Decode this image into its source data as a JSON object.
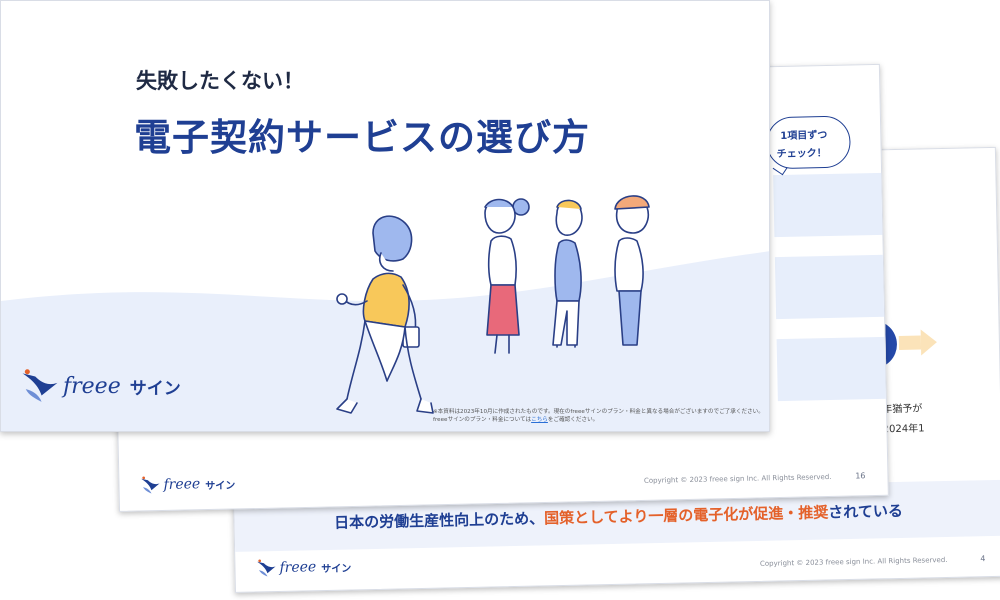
{
  "brand": {
    "logo_word": "freee",
    "logo_suffix": "サイン",
    "primary_color": "#1f3f93",
    "accent_color": "#e4612a"
  },
  "back_slide": {
    "band_text_prefix": "日本の労働生産性向上のため、",
    "band_text_highlight": "国策としてより一層の電子化が促進・推奨",
    "band_text_suffix": "されている",
    "side_text_1": "年猶予が",
    "side_text_2": "。2024年1",
    "copyright": "Copyright © 2023 freee sign Inc. All Rights Reserved.",
    "page_number": "4"
  },
  "middle_slide": {
    "bubble_line_1": "1項目ずつ",
    "bubble_line_2": "チェック！",
    "copyright": "Copyright © 2023 freee sign Inc. All Rights Reserved.",
    "page_number": "16"
  },
  "front_slide": {
    "subtitle": "失敗したくない！",
    "title": "電子契約サービスの選び方",
    "note_line_1": "※本資料は2023年10月に作成されたものです。現在のfreeeサインのプラン・料金と異なる場合がございますのでご了承ください。",
    "note_line_2_prefix": "freeeサインのプラン・料金については",
    "note_line_2_link": "こちら",
    "note_line_2_suffix": "をご確認ください。"
  }
}
